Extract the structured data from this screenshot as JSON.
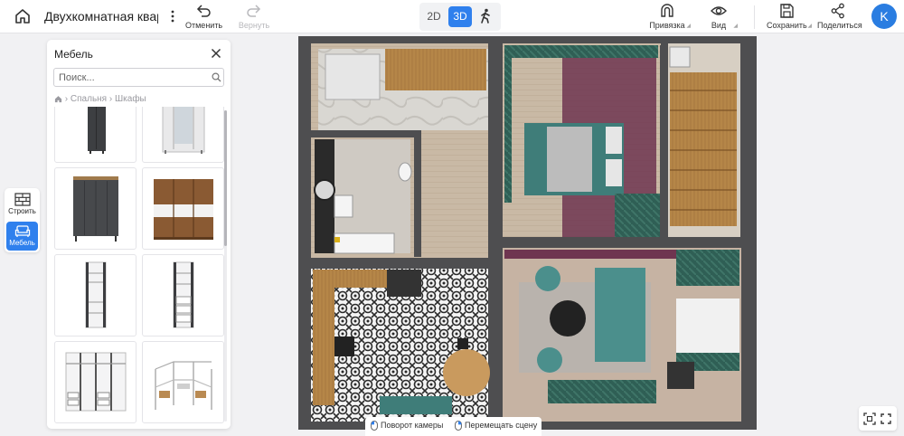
{
  "header": {
    "project_title": "Двухкомнатная квар",
    "undo_label": "Отменить",
    "redo_label": "Вернуть",
    "view_modes": [
      "2D",
      "3D"
    ],
    "active_view_mode": "3D",
    "snap_label": "Привязка",
    "view_label": "Вид",
    "save_label": "Сохранить",
    "share_label": "Поделиться",
    "avatar_initial": "K"
  },
  "rail": {
    "build_label": "Строить",
    "furniture_label": "Мебель",
    "active": "Мебель"
  },
  "panel": {
    "title": "Мебель",
    "search_placeholder": "Поиск...",
    "breadcrumb": [
      "Спальня",
      "Шкафы"
    ],
    "items": [
      {
        "icon": "dark-narrow-wardrobe-thumbnail"
      },
      {
        "icon": "white-wardrobe-with-mirror-thumbnail"
      },
      {
        "icon": "dark-grey-wardrobe-thumbnail"
      },
      {
        "icon": "oak-sliding-wardrobe-thumbnail"
      },
      {
        "icon": "open-shelf-rack-thumbnail"
      },
      {
        "icon": "rack-with-drawers-thumbnail"
      },
      {
        "icon": "wide-open-wardrobe-system-thumbnail"
      },
      {
        "icon": "wire-shelving-system-thumbnail"
      }
    ]
  },
  "hints": {
    "rotate_camera": "Поворот камеры",
    "move_scene": "Перемещать сцену"
  },
  "colors": {
    "accent": "#2f80ed",
    "avatar": "#2a7de1",
    "wall": "#4e4e50",
    "wood_floor": "#c8b8a4",
    "teal": "#4b8f8c",
    "curtain_green": "#2f5f55",
    "accent_wall": "#7a3a55"
  }
}
